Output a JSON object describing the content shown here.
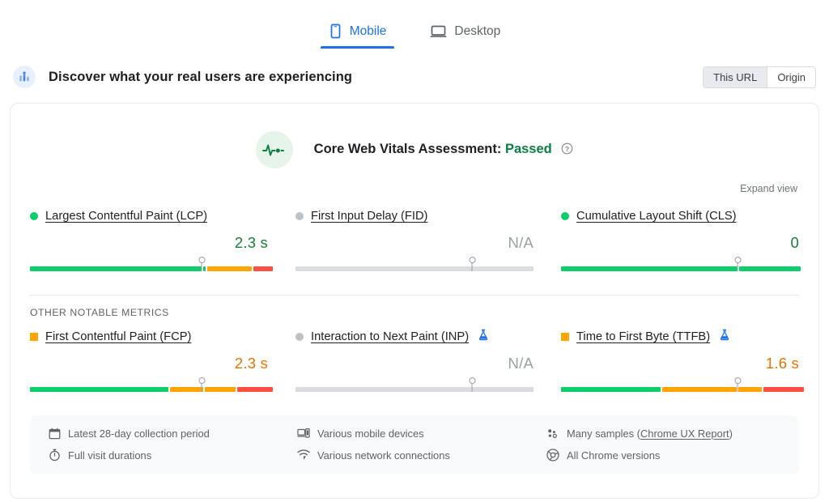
{
  "tabs": [
    {
      "label": "Mobile",
      "icon": "mobile-icon",
      "active": true
    },
    {
      "label": "Desktop",
      "icon": "desktop-icon",
      "active": false
    }
  ],
  "section": {
    "icon": "field-data-icon",
    "title": "Discover what your real users are experiencing",
    "scope_toggle": {
      "this_url": "This URL",
      "origin": "Origin",
      "selected": "This URL"
    }
  },
  "assessment": {
    "icon": "pulse-icon",
    "label": "Core Web Vitals Assessment:",
    "verdict": "Passed",
    "help_icon": "help-icon"
  },
  "expand_view": "Expand view",
  "other_metrics_label": "OTHER NOTABLE METRICS",
  "colors": {
    "good": "#0CCE6B",
    "good_text": "#188038",
    "needs_improvement": "#FFA400",
    "ni_text": "#E37400",
    "poor": "#FF4E42",
    "na": "#dadce0",
    "na_text": "#9aa0a6",
    "accent": "#1a73e8"
  },
  "core_web_vitals": [
    {
      "name": "Largest Contentful Paint (LCP)",
      "short": "LCP",
      "status": "good",
      "marker_shape": "circle",
      "value": "2.3 s",
      "experimental": false,
      "pin_percent": 72,
      "segments": [
        {
          "rating": "good",
          "percent": 72
        },
        {
          "rating": "good",
          "percent": 1
        },
        {
          "rating": "needs-improvement",
          "percent": 19
        },
        {
          "rating": "poor",
          "percent": 8
        }
      ]
    },
    {
      "name": "First Input Delay (FID)",
      "short": "FID",
      "status": "na",
      "marker_shape": "circle",
      "value": "N/A",
      "experimental": false,
      "pin_percent": 74,
      "segments": [
        {
          "rating": "na",
          "percent": 100
        }
      ]
    },
    {
      "name": "Cumulative Layout Shift (CLS)",
      "short": "CLS",
      "status": "good",
      "marker_shape": "circle",
      "value": "0",
      "experimental": false,
      "pin_percent": 74,
      "segments": [
        {
          "rating": "good",
          "percent": 74
        },
        {
          "rating": "good",
          "percent": 26
        }
      ]
    }
  ],
  "other_notable_metrics": [
    {
      "name": "First Contentful Paint (FCP)",
      "short": "FCP",
      "status": "needs-improvement",
      "marker_shape": "square",
      "value": "2.3 s",
      "experimental": false,
      "pin_percent": 72,
      "segments": [
        {
          "rating": "good",
          "percent": 58
        },
        {
          "rating": "needs-improvement",
          "percent": 14
        },
        {
          "rating": "needs-improvement",
          "percent": 13
        },
        {
          "rating": "poor",
          "percent": 15
        }
      ]
    },
    {
      "name": "Interaction to Next Paint (INP)",
      "short": "INP",
      "status": "na",
      "marker_shape": "circle",
      "value": "N/A",
      "experimental": true,
      "experimental_icon": "flask-icon",
      "pin_percent": 74,
      "segments": [
        {
          "rating": "na",
          "percent": 100
        }
      ]
    },
    {
      "name": "Time to First Byte (TTFB)",
      "short": "TTFB",
      "status": "needs-improvement",
      "marker_shape": "square",
      "value": "1.6 s",
      "experimental": true,
      "experimental_icon": "flask-icon",
      "pin_percent": 74,
      "segments": [
        {
          "rating": "good",
          "percent": 42
        },
        {
          "rating": "needs-improvement",
          "percent": 31
        },
        {
          "rating": "needs-improvement",
          "percent": 10
        },
        {
          "rating": "poor",
          "percent": 17
        }
      ]
    }
  ],
  "notes": [
    {
      "icon": "calendar-icon",
      "text": "Latest 28-day collection period",
      "link": null
    },
    {
      "icon": "devices-icon",
      "text": "Various mobile devices",
      "link": null
    },
    {
      "icon": "samples-icon",
      "text": "Many samples (",
      "link": "Chrome UX Report",
      "text_after": ")"
    },
    {
      "icon": "stopwatch-icon",
      "text": "Full visit durations",
      "link": null
    },
    {
      "icon": "network-icon",
      "text": "Various network connections",
      "link": null
    },
    {
      "icon": "chrome-icon",
      "text": "All Chrome versions",
      "link": null
    }
  ]
}
